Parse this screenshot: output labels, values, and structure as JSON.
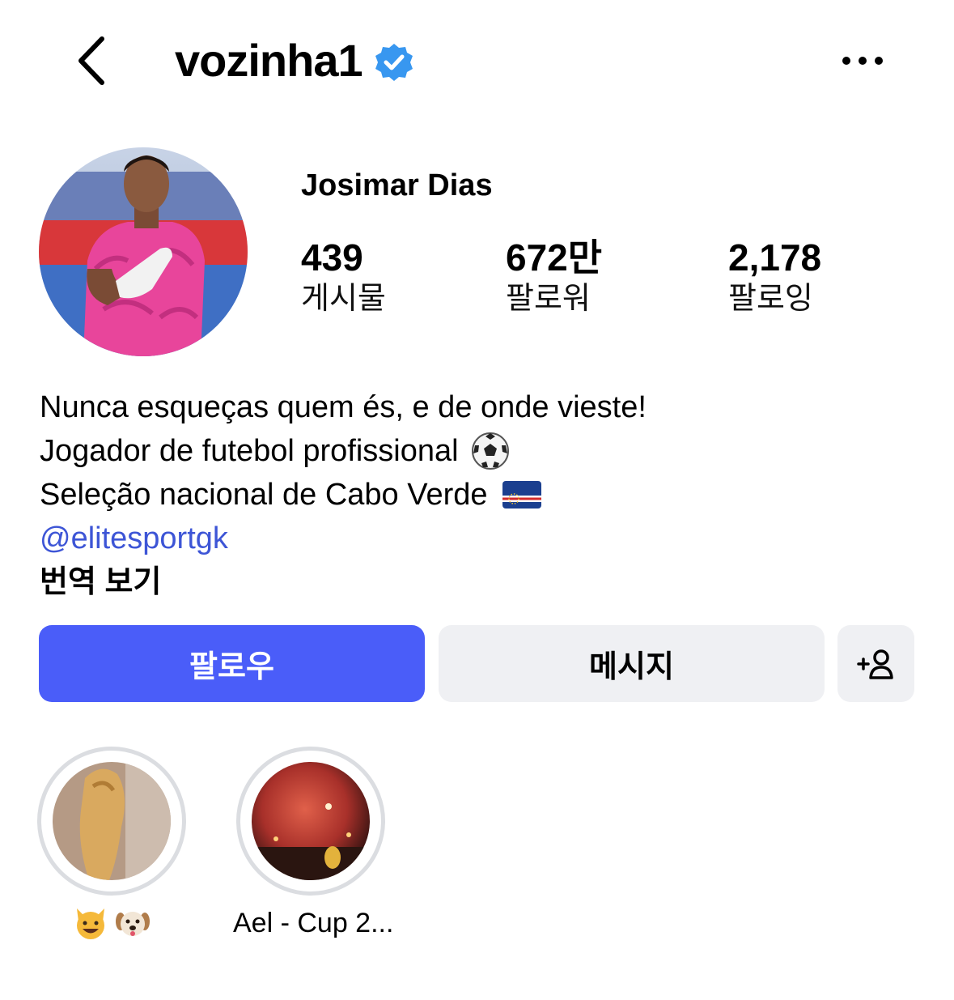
{
  "header": {
    "username": "vozinha1",
    "back_icon": "chevron-left-icon",
    "verified_icon": "verified-badge-icon",
    "verified_color": "#3897f0",
    "more_icon": "more-horizontal-icon"
  },
  "profile": {
    "display_name": "Josimar Dias",
    "stats": [
      {
        "value": "439",
        "label": "게시물"
      },
      {
        "value": "672만",
        "label": "팔로워"
      },
      {
        "value": "2,178",
        "label": "팔로잉"
      }
    ]
  },
  "bio": {
    "line1": "Nunca esqueças quem és, e de onde vieste!",
    "line2": "Jogador de futebol profissional",
    "line2_icon": "soccer-ball-icon",
    "line3": "Seleção nacional de Cabo Verde",
    "line3_icon": "cape-verde-flag-icon",
    "link": "@elitesportgk",
    "link_color": "#3d55d6",
    "translate": "번역 보기"
  },
  "actions": {
    "follow_label": "팔로우",
    "follow_color": "#4a5df9",
    "message_label": "메시지",
    "add_user_icon": "add-person-icon"
  },
  "highlights": [
    {
      "label_icons": [
        "cat-face-icon",
        "dog-face-icon"
      ]
    },
    {
      "label": "Ael - Cup 2..."
    }
  ]
}
